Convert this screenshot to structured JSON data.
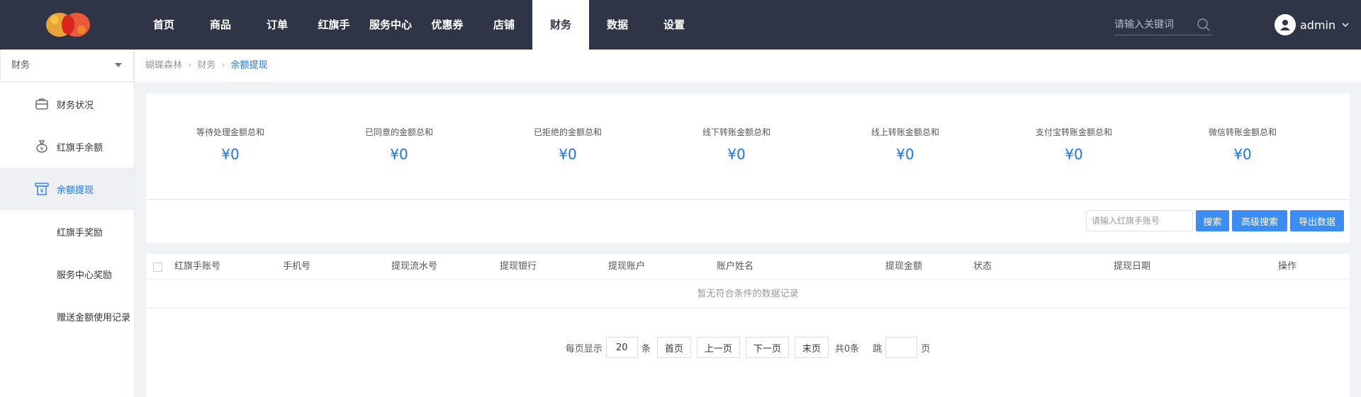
{
  "header": {
    "nav": [
      "首页",
      "商品",
      "订单",
      "红旗手",
      "服务中心",
      "优惠券",
      "店铺",
      "财务",
      "数据",
      "设置"
    ],
    "active_nav": "财务",
    "search_placeholder": "请输入关键词",
    "username": "admin"
  },
  "sidebar": {
    "module_select": "财务",
    "items": [
      {
        "label": "财务状况",
        "icon": "briefcase-icon"
      },
      {
        "label": "红旗手余额",
        "icon": "money-bag-icon"
      },
      {
        "label": "余额提现",
        "icon": "withdraw-icon"
      },
      {
        "label": "红旗手奖励",
        "icon": ""
      },
      {
        "label": "服务中心奖励",
        "icon": ""
      },
      {
        "label": "赠送金额使用记录",
        "icon": ""
      }
    ],
    "active_item": "余额提现"
  },
  "breadcrumb": [
    "蝴蝶森林",
    "财务",
    "余额提现"
  ],
  "stats": [
    {
      "label": "等待处理金额总和",
      "value": "¥0"
    },
    {
      "label": "已同意的金额总和",
      "value": "¥0"
    },
    {
      "label": "已拒绝的金额总和",
      "value": "¥0"
    },
    {
      "label": "线下转账金额总和",
      "value": "¥0"
    },
    {
      "label": "线上转账金额总和",
      "value": "¥0"
    },
    {
      "label": "支付宝转账金额总和",
      "value": "¥0"
    },
    {
      "label": "微信转账金额总和",
      "value": "¥0"
    }
  ],
  "toolbar": {
    "account_placeholder": "请输入红旗手账号",
    "search_label": "搜索",
    "advanced_label": "高级搜索",
    "export_label": "导出数据"
  },
  "table": {
    "columns": [
      "红旗手账号",
      "手机号",
      "提现流水号",
      "提现银行",
      "提现账户",
      "账户姓名",
      "提现金额",
      "状态",
      "提现日期",
      "操作"
    ],
    "empty_text": "暂无符合条件的数据记录"
  },
  "pagination": {
    "per_page_prefix": "每页显示",
    "per_page_value": "20",
    "per_page_suffix": "条",
    "first": "首页",
    "prev": "上一页",
    "next": "下一页",
    "last": "末页",
    "total": "共0条",
    "jump_prefix": "跳",
    "jump_suffix": "页"
  },
  "colors": {
    "topbar": "#2f3546",
    "accent": "#1a73e8",
    "button": "#3c8cf2"
  }
}
